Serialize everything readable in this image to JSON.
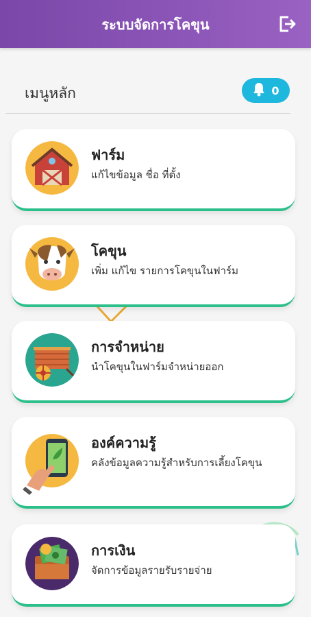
{
  "app": {
    "title": "ระบบจัดการโคขุน"
  },
  "header": {
    "logout_icon": "logout-icon"
  },
  "menu": {
    "heading": "เมนูหลัก",
    "notifications": {
      "icon": "bell-icon",
      "count": "0"
    }
  },
  "cards": [
    {
      "title": "ฟาร์ม",
      "description": "แก้ไขข้อมูล ชื่อ ที่ตั้ง",
      "icon": "barn-icon"
    },
    {
      "title": "โคขุน",
      "description": "เพิ่ม แก้ไข รายการโคขุนในฟาร์ม",
      "icon": "cow-icon"
    },
    {
      "title": "การจำหน่าย",
      "description": "นำโคขุนในฟาร์มจำหน่ายออก",
      "icon": "cart-icon"
    },
    {
      "title": "องค์ความรู้",
      "description": "คลังข้อมูลความรู้สำหรับการเลี้ยงโคขุน",
      "icon": "phone-knowledge-icon"
    },
    {
      "title": "การเงิน",
      "description": "จัดการข้อมูลรายรับรายจ่าย",
      "icon": "money-icon"
    }
  ],
  "colors": {
    "header": "#8c56b8",
    "badge": "#1eb7dd",
    "card_accent": "#2bbf8a"
  }
}
